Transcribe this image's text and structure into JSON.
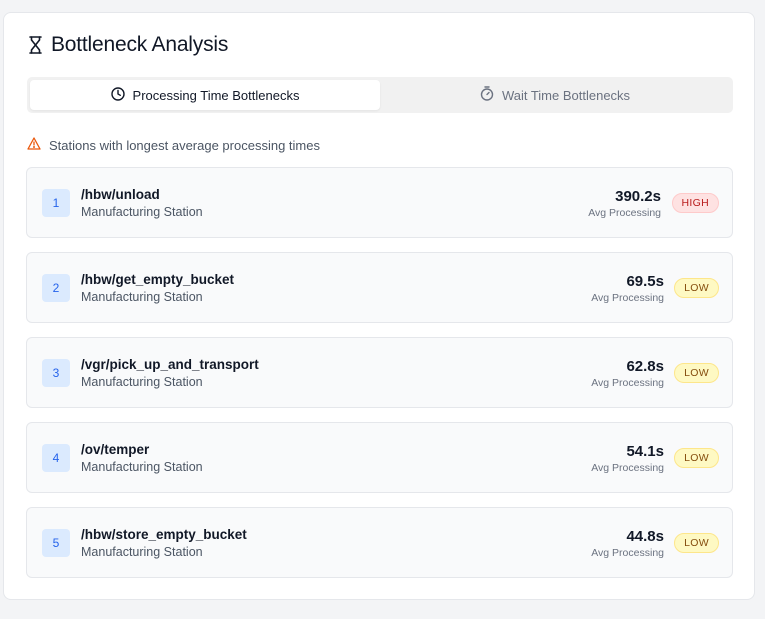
{
  "header": {
    "title": "Bottleneck Analysis",
    "icon": "hourglass-icon"
  },
  "tabs": [
    {
      "label": "Processing Time Bottlenecks",
      "icon": "clock-icon",
      "active": true
    },
    {
      "label": "Wait Time Bottlenecks",
      "icon": "stopwatch-icon",
      "active": false
    }
  ],
  "notice": {
    "text": "Stations with longest average processing times",
    "icon": "warning-icon",
    "color": "#ea580c"
  },
  "stations": [
    {
      "rank": "1",
      "name": "/hbw/unload",
      "subtitle": "Manufacturing Station",
      "time": "390.2s",
      "metric_label": "Avg Processing",
      "severity": "HIGH"
    },
    {
      "rank": "2",
      "name": "/hbw/get_empty_bucket",
      "subtitle": "Manufacturing Station",
      "time": "69.5s",
      "metric_label": "Avg Processing",
      "severity": "LOW"
    },
    {
      "rank": "3",
      "name": "/vgr/pick_up_and_transport",
      "subtitle": "Manufacturing Station",
      "time": "62.8s",
      "metric_label": "Avg Processing",
      "severity": "LOW"
    },
    {
      "rank": "4",
      "name": "/ov/temper",
      "subtitle": "Manufacturing Station",
      "time": "54.1s",
      "metric_label": "Avg Processing",
      "severity": "LOW"
    },
    {
      "rank": "5",
      "name": "/hbw/store_empty_bucket",
      "subtitle": "Manufacturing Station",
      "time": "44.8s",
      "metric_label": "Avg Processing",
      "severity": "LOW"
    }
  ],
  "colors": {
    "rank_bg": "#dbeafe",
    "rank_fg": "#2563eb",
    "high_bg": "#fee2e2",
    "high_fg": "#b91c1c",
    "low_bg": "#fef9c3",
    "low_fg": "#854d0e"
  }
}
